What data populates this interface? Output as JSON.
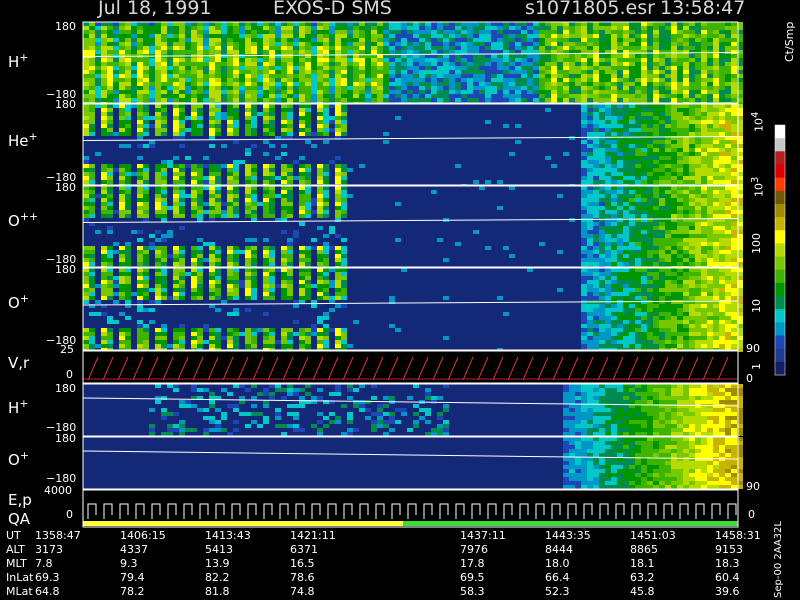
{
  "title": {
    "date": "Jul 18, 1991",
    "mission": "EXOS-D SMS",
    "file": "s1071805.esr",
    "time": "13:58:47"
  },
  "panels": [
    {
      "species": "H",
      "charge": "+",
      "y_top": "180",
      "y_bottom": "−180"
    },
    {
      "species": "He",
      "charge": "+",
      "y_top": "180",
      "y_bottom": "−180"
    },
    {
      "species": "O",
      "charge": "++",
      "y_top": "180",
      "y_bottom": "−180"
    },
    {
      "species": "O",
      "charge": "+",
      "y_top": "180",
      "y_bottom": "−180"
    }
  ],
  "vr_panel": {
    "label": "V,r",
    "y_top": "25",
    "y_zero": "0",
    "right_top": "90"
  },
  "lower_panels": [
    {
      "species": "H",
      "charge": "+",
      "y_top": "180",
      "y_bottom": "−180"
    },
    {
      "species": "O",
      "charge": "+",
      "y_top": "180",
      "y_bottom": "−180",
      "right_label": "90"
    }
  ],
  "ep_panel": {
    "label_line1": "E,p",
    "label_line2": "QA",
    "y_top": "4000",
    "y_zero": "0",
    "right_zero": "0"
  },
  "colorbar": {
    "unit": "Ct/Smp",
    "ticks": [
      {
        "base": "10",
        "exp": "4"
      },
      {
        "base": "10",
        "exp": "3"
      },
      {
        "base": "100",
        "exp": ""
      },
      {
        "base": "10",
        "exp": ""
      },
      {
        "base": "1",
        "exp": ""
      }
    ],
    "bottom_value": "0",
    "colors": [
      "#ffffff",
      "#c8c8c8",
      "#b41e1e",
      "#dc0000",
      "#ff3c00",
      "#6e5a00",
      "#a08c00",
      "#c8b400",
      "#ffff00",
      "#b4dc00",
      "#78c800",
      "#3cb400",
      "#009600",
      "#008c50",
      "#00c8c8",
      "#0096c8",
      "#1e46b4",
      "#1e3c8c",
      "#141e64"
    ]
  },
  "footer_code": "Sep-00 2AA32L",
  "times": {
    "row_labels": [
      "UT",
      "ALT",
      "MLT",
      "InLat",
      "MLat"
    ],
    "columns": [
      {
        "UT": "1358:47",
        "ALT": "3173",
        "MLT": "7.8",
        "InLat": "69.3",
        "MLat": "64.8"
      },
      {
        "UT": "1406:15",
        "ALT": "4337",
        "MLT": "9.3",
        "InLat": "79.4",
        "MLat": "78.2"
      },
      {
        "UT": "1413:43",
        "ALT": "5413",
        "MLT": "13.9",
        "InLat": "82.2",
        "MLat": "81.8"
      },
      {
        "UT": "1421:11",
        "ALT": "6371",
        "MLT": "16.5",
        "InLat": "78.6",
        "MLat": "74.8"
      },
      {
        "UT": "1437:11",
        "ALT": "7976",
        "MLT": "17.8",
        "InLat": "69.5",
        "MLat": "58.3"
      },
      {
        "UT": "1443:35",
        "ALT": "8444",
        "MLT": "18.0",
        "InLat": "66.4",
        "MLat": "52.3"
      },
      {
        "UT": "1451:03",
        "ALT": "8865",
        "MLT": "18.1",
        "InLat": "63.2",
        "MLat": "45.8"
      },
      {
        "UT": "1458:31",
        "ALT": "9153",
        "MLT": "18.3",
        "InLat": "60.4",
        "MLat": "39.6"
      }
    ]
  },
  "chart_data": {
    "type": "heatmap",
    "title": "Jul 18, 1991   EXOS-D SMS",
    "xlabel": "UT",
    "x_ticks": [
      "1358:47",
      "1406:15",
      "1413:43",
      "1421:11",
      "1437:11",
      "1443:35",
      "1451:03",
      "1458:31"
    ],
    "ylim": [
      -180,
      180
    ],
    "colorbar_unit": "Ct/Smp",
    "colorbar_range": [
      0,
      10000
    ],
    "panels": [
      "H+",
      "He+",
      "O++",
      "O+",
      "V,r",
      "H+",
      "O+",
      "E,p QA"
    ],
    "vr_ylim": [
      0,
      25
    ],
    "ep_ylim": [
      0,
      4000
    ]
  }
}
